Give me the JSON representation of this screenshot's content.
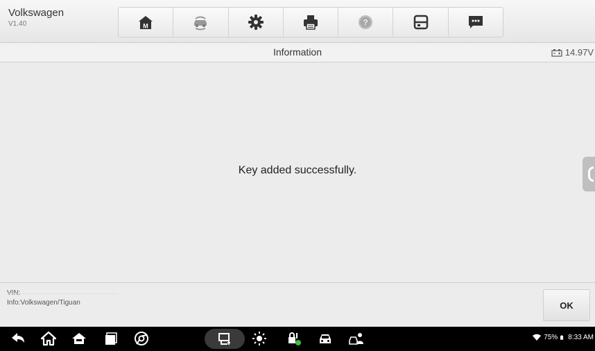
{
  "header": {
    "app_name": "Volkswagen",
    "version": "V1.40",
    "toolbar": [
      {
        "icon": "home-icon"
      },
      {
        "icon": "vehicle-swap-icon"
      },
      {
        "icon": "settings-gear-icon"
      },
      {
        "icon": "printer-icon"
      },
      {
        "icon": "help-icon"
      },
      {
        "icon": "save-icon"
      },
      {
        "icon": "message-icon"
      }
    ]
  },
  "titlebar": {
    "title": "Information",
    "voltage": "14.97V"
  },
  "main": {
    "message": "Key added successfully."
  },
  "footer": {
    "vin_label": "VIN:",
    "info": "Info:Volkswagen/Tiguan",
    "ok_label": "OK"
  },
  "statusbar": {
    "battery": "75%",
    "time": "8:33 AM"
  },
  "colors": {
    "toolbar_bg": "#ececec",
    "nav_bg": "#000000",
    "accent_green": "#3fbf3f"
  }
}
